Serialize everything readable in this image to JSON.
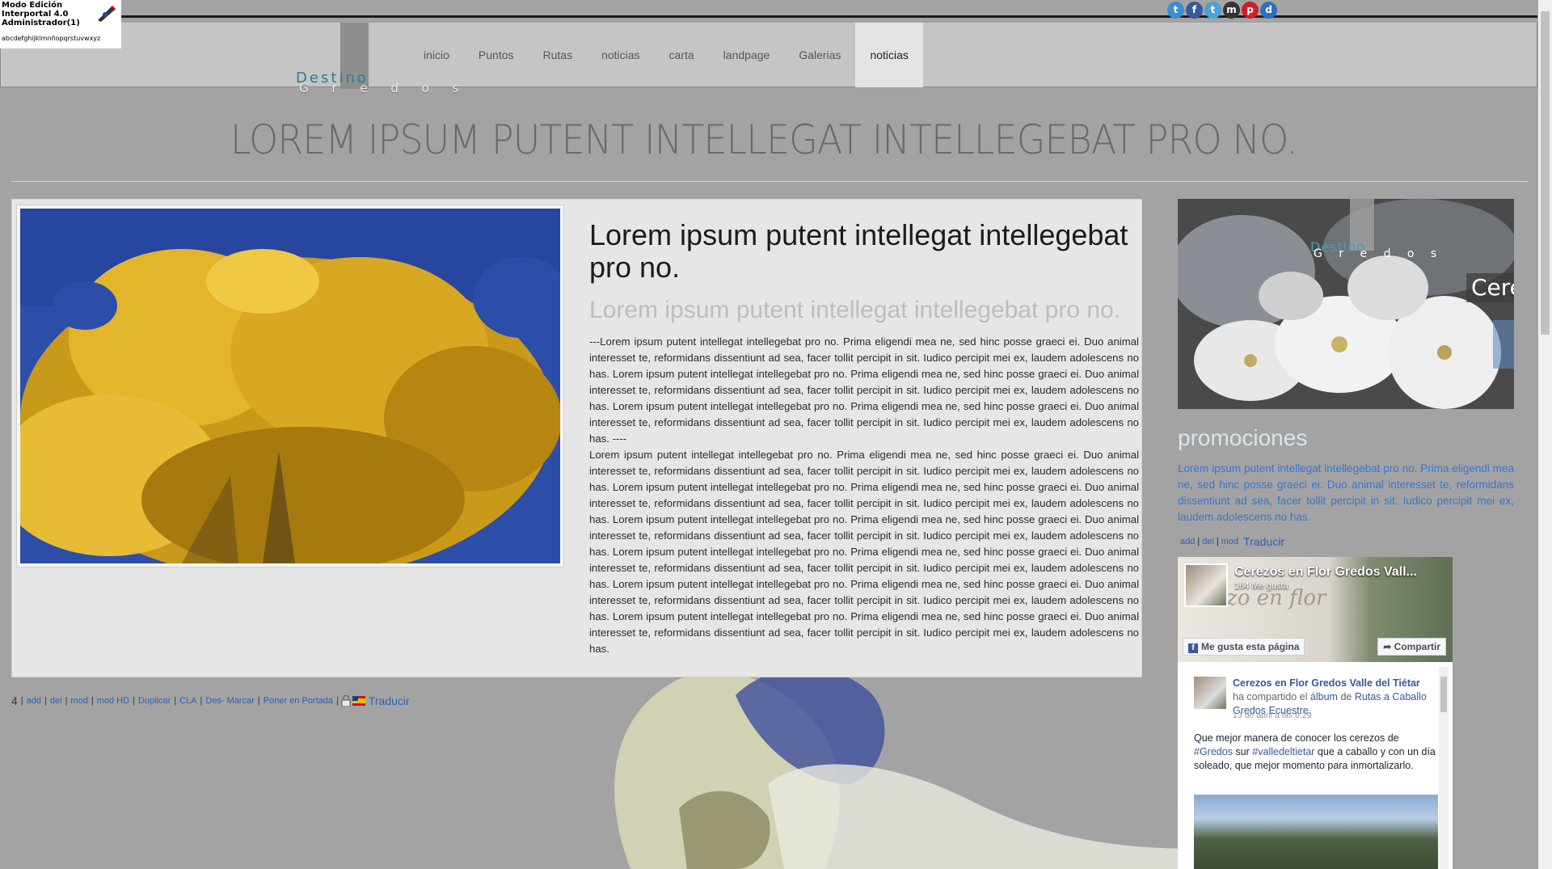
{
  "admin": {
    "line1": "Modo Edición",
    "line2": "Interportal 4.0",
    "line3": "Administrador(1)",
    "alphabet": "abcdefghijklmnñopqrstuvwxyz"
  },
  "social": {
    "icons": [
      "twitter-icon",
      "facebook-icon",
      "tuenti-icon",
      "myspace-icon",
      "pinterest-icon",
      "delicious-icon"
    ],
    "glyphs": [
      "t",
      "f",
      "t",
      "m",
      "p",
      "d"
    ],
    "colors": [
      "#3a8fd1",
      "#3b5998",
      "#4aa0d8",
      "#333333",
      "#cb2027",
      "#2f6dbf"
    ]
  },
  "logo": {
    "top": "Destino",
    "bottom": "G r e d o s"
  },
  "nav": {
    "items": [
      "inicio",
      "Puntos",
      "Rutas",
      "noticias",
      "carta",
      "landpage",
      "Galerias",
      "noticias"
    ],
    "active_index": 7
  },
  "page_title": "LOREM IPSUM PUTENT INTELLEGAT INTELLEGEBAT PRO NO.",
  "article": {
    "heading": "Lorem ipsum putent intellegat intellegebat pro no.",
    "subheading": "Lorem ipsum putent intellegat intellegebat pro no.",
    "paragraph1": "---Lorem ipsum putent intellegat intellegebat pro no. Prima eligendi mea ne, sed hinc posse graeci ei. Duo animal interesset te, reformidans dissentiunt ad sea, facer tollit percipit in sit. Iudico percipit mei ex, laudem adolescens no has. Lorem ipsum putent intellegat intellegebat pro no. Prima eligendi mea ne, sed hinc posse graeci ei. Duo animal interesset te, reformidans dissentiunt ad sea, facer tollit percipit in sit. Iudico percipit mei ex, laudem adolescens no has. Lorem ipsum putent intellegat intellegebat pro no. Prima eligendi mea ne, sed hinc posse graeci ei. Duo animal interesset te, reformidans dissentiunt ad sea, facer tollit percipit in sit. Iudico percipit mei ex, laudem adolescens no has. ----",
    "paragraph2": "Lorem ipsum putent intellegat intellegebat pro no. Prima eligendi mea ne, sed hinc posse graeci ei. Duo animal interesset te, reformidans dissentiunt ad sea, facer tollit percipit in sit. Iudico percipit mei ex, laudem adolescens no has. Lorem ipsum putent intellegat intellegebat pro no. Prima eligendi mea ne, sed hinc posse graeci ei. Duo animal interesset te, reformidans dissentiunt ad sea, facer tollit percipit in sit. Iudico percipit mei ex, laudem adolescens no has. Lorem ipsum putent intellegat intellegebat pro no. Prima eligendi mea ne, sed hinc posse graeci ei. Duo animal interesset te, reformidans dissentiunt ad sea, facer tollit percipit in sit. Iudico percipit mei ex, laudem adolescens no has. Lorem ipsum putent intellegat intellegebat pro no. Prima eligendi mea ne, sed hinc posse graeci ei. Duo animal interesset te, reformidans dissentiunt ad sea, facer tollit percipit in sit. Iudico percipit mei ex, laudem adolescens no has. Lorem ipsum putent intellegat intellegebat pro no. Prima eligendi mea ne, sed hinc posse graeci ei. Duo animal interesset te, reformidans dissentiunt ad sea, facer tollit percipit in sit. Iudico percipit mei ex, laudem adolescens no has. Lorem ipsum putent intellegat intellegebat pro no. Prima eligendi mea ne, sed hinc posse graeci ei. Duo animal interesset te, reformidans dissentiunt ad sea, facer tollit percipit in sit. Iudico percipit mei ex, laudem adolescens no has."
  },
  "tools": {
    "count": "4",
    "links": [
      "add",
      "del",
      "mod",
      "mod HD",
      "Duplicar",
      "CLA",
      "Des- Marcar",
      "Poner en Portada"
    ],
    "translate": "Traducir"
  },
  "sidebar": {
    "banner": {
      "top": "Destino",
      "bottom": "G r e d o s",
      "caption": "Cere"
    },
    "promo_title": "promociones",
    "promo_text": "Lorem ipsum putent intellegat intellegebat pro no. Prima eligendi mea ne, sed hinc posse graeci ei. Duo animal interesset te, reformidans dissentiunt ad sea, facer tollit percipit in sit. Iudico percipit mei ex, laudem adolescens no has.",
    "tools": [
      "add",
      "del",
      "mod"
    ],
    "translate": "Traducir"
  },
  "facebook": {
    "page_name": "Cerezos en Flor Gredos Vall...",
    "likes": "164 Me gusta",
    "like_button": "Me gusta esta página",
    "share_button": "Compartir",
    "post": {
      "author": "Cerezos en Flor Gredos Valle del Tiétar",
      "action": "ha compartido el",
      "album_word": "álbum",
      "of": "de",
      "album_name": "Rutas a Caballo Gredos Ecuestre.",
      "date": "13 de abril a las 6:29",
      "text1": "Que mejor manera de conocer los cerezos de",
      "tag1": "#Gredos",
      "text2": "sur",
      "tag2": "#valledeltietar",
      "text3": "que a caballo y con un día soleado, que mejor momento para inmortalizarlo."
    }
  }
}
